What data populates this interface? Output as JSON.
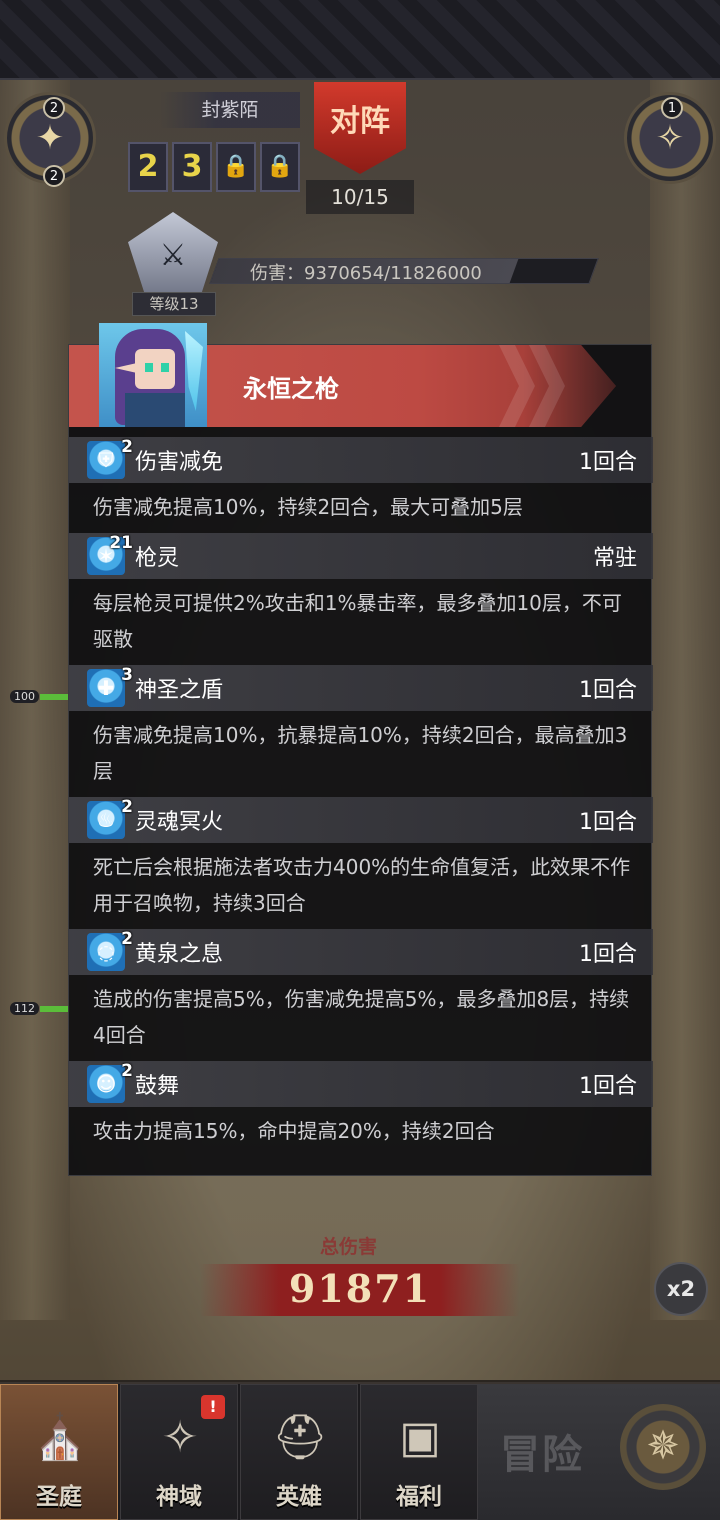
{
  "header": {
    "left_medal_count_top": "2",
    "left_medal_count_bottom": "2",
    "right_medal_count": "1",
    "opponent_name": "封紫陌",
    "vs_label": "对阵",
    "slots": [
      "2",
      "3"
    ],
    "progress": "10/15",
    "damage_text": "伤害：9370654/11826000",
    "damage_fraction": 0.79,
    "level_text": "等级13"
  },
  "units": {
    "unit1_hp": "100",
    "unit2_hp": "112"
  },
  "popup": {
    "hero_name": "永恒之枪",
    "buffs": [
      {
        "stack": "2",
        "name": "伤害减免",
        "duration": "1回合",
        "desc": "伤害减免提高10%，持续2回合，最大可叠加5层",
        "icon": "shield-up-icon"
      },
      {
        "stack": "21",
        "name": "枪灵",
        "duration": "常驻",
        "desc": "每层枪灵可提供2%攻击和1%暴击率，最多叠加10层，不可驱散",
        "icon": "spear-spirit-icon"
      },
      {
        "stack": "3",
        "name": "神圣之盾",
        "duration": "1回合",
        "desc": "伤害减免提高10%，抗暴提高10%，持续2回合，最高叠加3层",
        "icon": "holy-shield-icon"
      },
      {
        "stack": "2",
        "name": "灵魂冥火",
        "duration": "1回合",
        "desc": "死亡后会根据施法者攻击力400%的生命值复活，此效果不作用于召唤物，持续3回合",
        "icon": "soul-fire-icon"
      },
      {
        "stack": "2",
        "name": "黄泉之息",
        "duration": "1回合",
        "desc": "造成的伤害提高5%，伤害减免提高5%，最多叠加8层，持续4回合",
        "icon": "underworld-breath-icon"
      },
      {
        "stack": "2",
        "name": "鼓舞",
        "duration": "1回合",
        "desc": "攻击力提高15%，命中提高20%，持续2回合",
        "icon": "inspire-icon"
      }
    ]
  },
  "battle": {
    "total_label": "总伤害",
    "total_value": "91871",
    "speed_label": "x2"
  },
  "nav": {
    "tabs": [
      {
        "label": "圣庭",
        "icon": "temple-icon"
      },
      {
        "label": "神域",
        "icon": "divine-realm-icon",
        "badge": "!"
      },
      {
        "label": "英雄",
        "icon": "helmet-icon"
      },
      {
        "label": "福利",
        "icon": "treasure-chest-icon"
      }
    ],
    "adventure_label": "冒险"
  },
  "colors": {
    "accent_red": "#c4544c",
    "popup_bg": "#0e0e10",
    "active_tab": "#7a5236"
  }
}
